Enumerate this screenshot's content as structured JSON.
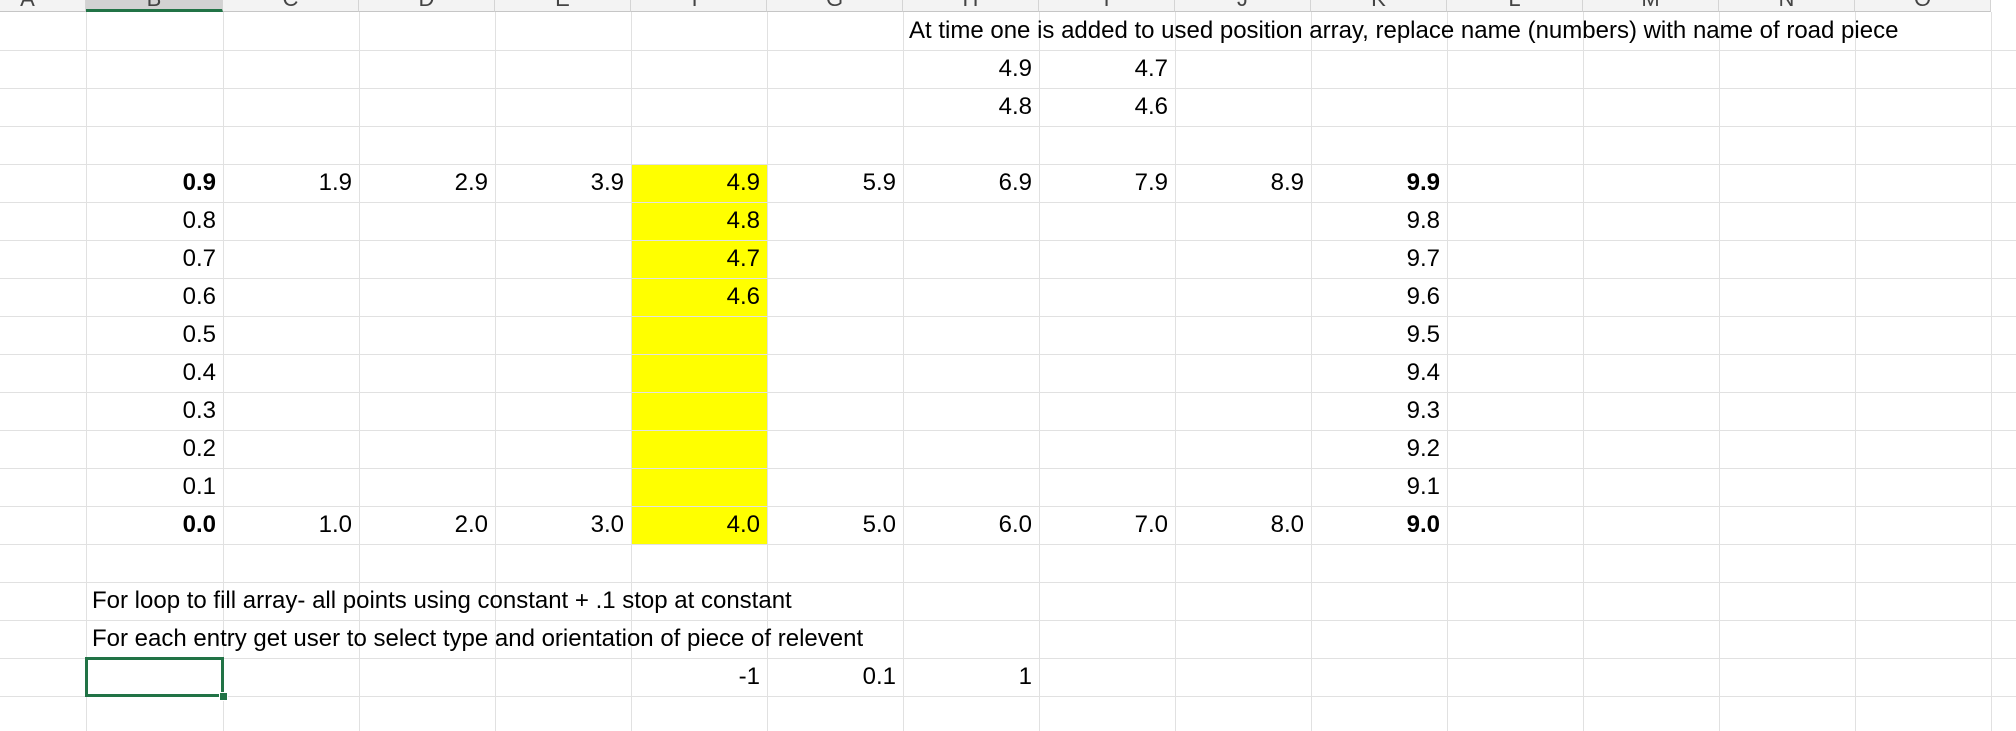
{
  "columns": [
    "A",
    "B",
    "C",
    "D",
    "E",
    "F",
    "G",
    "H",
    "I",
    "J",
    "K",
    "L",
    "M",
    "N",
    "O"
  ],
  "active_column": "B",
  "highlight_color": "#ffff00",
  "selection_color": "#217346",
  "note_top": "At time one is added to used position array, replace name (numbers) with name of road piece",
  "top_values": [
    {
      "h": "4.9",
      "i": "4.7"
    },
    {
      "h": "4.8",
      "i": "4.6"
    }
  ],
  "grid_top": [
    "0.9",
    "1.9",
    "2.9",
    "3.9",
    "4.9",
    "5.9",
    "6.9",
    "7.9",
    "8.9",
    "9.9"
  ],
  "col_b": [
    "0.8",
    "0.7",
    "0.6",
    "0.5",
    "0.4",
    "0.3",
    "0.2",
    "0.1"
  ],
  "col_f": [
    "4.8",
    "4.7",
    "4.6"
  ],
  "col_k": [
    "9.8",
    "9.7",
    "9.6",
    "9.5",
    "9.4",
    "9.3",
    "9.2",
    "9.1"
  ],
  "grid_bottom": [
    "0.0",
    "1.0",
    "2.0",
    "3.0",
    "4.0",
    "5.0",
    "6.0",
    "7.0",
    "8.0",
    "9.0"
  ],
  "notes": [
    "For loop to fill array- all points using constant + .1 stop at constant",
    "For each entry get user to select type and orientation of piece of relevent"
  ],
  "last_row": [
    "-1",
    "0.1",
    "1"
  ]
}
